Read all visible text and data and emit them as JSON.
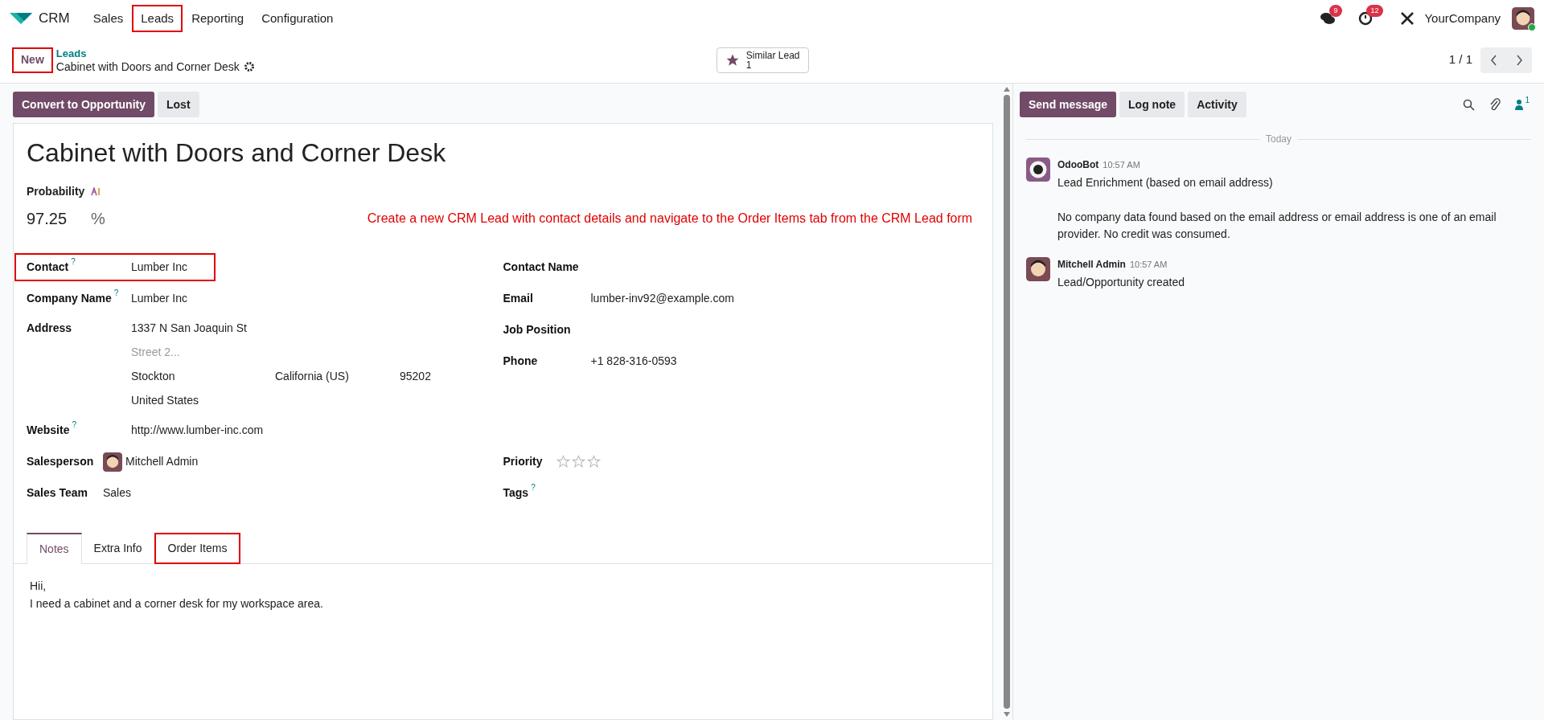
{
  "app": {
    "name": "CRM"
  },
  "menu": [
    {
      "label": "Sales",
      "highlighted": false
    },
    {
      "label": "Leads",
      "highlighted": true
    },
    {
      "label": "Reporting",
      "highlighted": false
    },
    {
      "label": "Configuration",
      "highlighted": false
    }
  ],
  "systray": {
    "messages_count": "9",
    "activities_count": "12",
    "company": "YourCompany"
  },
  "breadcrumb": {
    "parent": "Leads",
    "current": "Cabinet with Doors and Corner Desk"
  },
  "new_button": {
    "label": "New",
    "highlighted": true
  },
  "smart_button": {
    "label": "Similar Lead",
    "value": "1"
  },
  "pager": {
    "text": "1 / 1"
  },
  "actions": [
    {
      "label": "Convert to Opportunity",
      "kind": "primary"
    },
    {
      "label": "Lost",
      "kind": "secondary"
    }
  ],
  "form": {
    "title": "Cabinet with Doors and Corner Desk",
    "probability": {
      "label": "Probability",
      "value": "97.25",
      "unit": "%"
    },
    "instruction": "Create a new CRM Lead with contact details and navigate to the Order Items tab from the CRM Lead form",
    "left_group": [
      {
        "kind": "text",
        "label": "Contact",
        "tooltip_mark": "?",
        "value": "Lumber Inc",
        "highlighted": true
      },
      {
        "kind": "text",
        "label": "Company Name",
        "tooltip_mark": "?",
        "value": "Lumber Inc",
        "highlighted": false
      },
      {
        "kind": "address",
        "label": "Address",
        "street": "1337 N San Joaquin St",
        "street2_placeholder": "Street 2...",
        "city": "Stockton",
        "state": "California (US)",
        "zip": "95202",
        "country": "United States"
      },
      {
        "kind": "text",
        "label": "Website",
        "tooltip_mark": "?",
        "value": "http://www.lumber-inc.com",
        "highlighted": false
      }
    ],
    "right_group": [
      {
        "kind": "text",
        "label": "Contact Name",
        "highlighted": false
      },
      {
        "kind": "text",
        "label": "Email",
        "value": "lumber-inv92@example.com",
        "highlighted": false
      },
      {
        "kind": "text",
        "label": "Job Position",
        "highlighted": false
      },
      {
        "kind": "text",
        "label": "Phone",
        "value": "+1 828-316-0593",
        "highlighted": false
      }
    ],
    "left_group_2": [
      {
        "kind": "user",
        "label": "Salesperson",
        "value": "Mitchell Admin"
      },
      {
        "kind": "text",
        "label": "Sales Team",
        "value": "Sales",
        "highlighted": false
      }
    ],
    "right_group_2": [
      {
        "kind": "stars",
        "label": "Priority",
        "stars": 0
      },
      {
        "kind": "text",
        "label": "Tags",
        "tooltip_mark": "?",
        "highlighted": false
      }
    ],
    "tabs": [
      {
        "label": "Notes",
        "selected": true,
        "highlighted": false
      },
      {
        "label": "Extra Info",
        "selected": false,
        "highlighted": false
      },
      {
        "label": "Order Items",
        "selected": false,
        "highlighted": true
      }
    ],
    "notes": [
      "Hii,",
      "I need a cabinet and a corner desk for my workspace area."
    ]
  },
  "chatter": {
    "buttons": [
      {
        "label": "Send message",
        "kind": "primary"
      },
      {
        "label": "Log note",
        "kind": "secondary"
      },
      {
        "label": "Activity",
        "kind": "secondary"
      }
    ],
    "followers_count": "1",
    "date_separator": "Today",
    "messages": [
      {
        "author": "OdooBot",
        "kind": "bot",
        "time": "10:57 AM",
        "body": [
          "Lead Enrichment (based on email address)",
          "No company data found based on the email address or email address is one of an email provider. No credit was consumed."
        ]
      },
      {
        "author": "Mitchell Admin",
        "kind": "user",
        "time": "10:57 AM",
        "body": [
          "Lead/Opportunity created"
        ]
      }
    ]
  }
}
